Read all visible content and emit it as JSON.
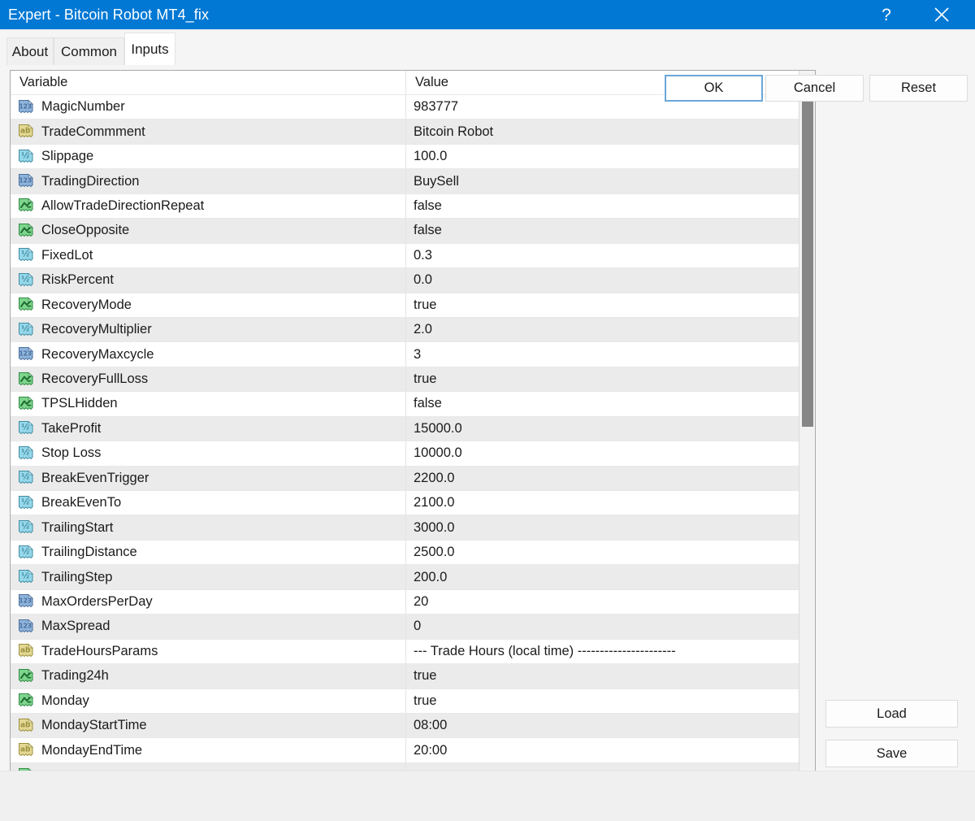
{
  "window": {
    "title": "Expert - Bitcoin Robot MT4_fix",
    "titlebar_color": "#0078d4",
    "help_icon": "question-mark-icon",
    "close_icon": "close-icon"
  },
  "tabs": [
    {
      "label": "About",
      "selected": false
    },
    {
      "label": "Common",
      "selected": false
    },
    {
      "label": "Inputs",
      "selected": true
    }
  ],
  "table": {
    "columns": [
      "Variable",
      "Value"
    ],
    "rows": [
      {
        "icon": "integer-icon",
        "name": "MagicNumber",
        "value": "983777"
      },
      {
        "icon": "string-icon",
        "name": "TradeCommment",
        "value": "Bitcoin Robot"
      },
      {
        "icon": "double-icon",
        "name": "Slippage",
        "value": "100.0"
      },
      {
        "icon": "integer-icon",
        "name": "TradingDirection",
        "value": "BuySell"
      },
      {
        "icon": "bool-icon",
        "name": "AllowTradeDirectionRepeat",
        "value": "false"
      },
      {
        "icon": "bool-icon",
        "name": "CloseOpposite",
        "value": "false"
      },
      {
        "icon": "double-icon",
        "name": "FixedLot",
        "value": "0.3"
      },
      {
        "icon": "double-icon",
        "name": "RiskPercent",
        "value": "0.0"
      },
      {
        "icon": "bool-icon",
        "name": "RecoveryMode",
        "value": "true"
      },
      {
        "icon": "double-icon",
        "name": "RecoveryMultiplier",
        "value": "2.0"
      },
      {
        "icon": "integer-icon",
        "name": "RecoveryMaxcycle",
        "value": "3"
      },
      {
        "icon": "bool-icon",
        "name": "RecoveryFullLoss",
        "value": "true"
      },
      {
        "icon": "bool-icon",
        "name": "TPSLHidden",
        "value": "false"
      },
      {
        "icon": "double-icon",
        "name": "TakeProfit",
        "value": "15000.0"
      },
      {
        "icon": "double-icon",
        "name": "Stop Loss",
        "value": "10000.0"
      },
      {
        "icon": "double-icon",
        "name": "BreakEvenTrigger",
        "value": "2200.0"
      },
      {
        "icon": "double-icon",
        "name": "BreakEvenTo",
        "value": "2100.0"
      },
      {
        "icon": "double-icon",
        "name": "TrailingStart",
        "value": "3000.0"
      },
      {
        "icon": "double-icon",
        "name": "TrailingDistance",
        "value": "2500.0"
      },
      {
        "icon": "double-icon",
        "name": "TrailingStep",
        "value": "200.0"
      },
      {
        "icon": "integer-icon",
        "name": "MaxOrdersPerDay",
        "value": "20"
      },
      {
        "icon": "integer-icon",
        "name": "MaxSpread",
        "value": "0"
      },
      {
        "icon": "string-icon",
        "name": "TradeHoursParams",
        "value": "--- Trade Hours  (local time) ----------------------"
      },
      {
        "icon": "bool-icon",
        "name": "Trading24h",
        "value": "true"
      },
      {
        "icon": "bool-icon",
        "name": "Monday",
        "value": "true"
      },
      {
        "icon": "string-icon",
        "name": "MondayStartTime",
        "value": "08:00"
      },
      {
        "icon": "string-icon",
        "name": "MondayEndTime",
        "value": "20:00"
      },
      {
        "icon": "bool-icon",
        "name": "",
        "value": ""
      }
    ]
  },
  "scrollbar": {
    "name": "vertical-scrollbar"
  },
  "side_buttons": {
    "load": "Load",
    "save": "Save"
  },
  "footer_buttons": {
    "ok": "OK",
    "cancel": "Cancel",
    "reset": "Reset"
  },
  "colors": {
    "accent": "#0078d4",
    "integer_icon": "#7ba3d0",
    "string_icon": "#e0d48a",
    "double_icon": "#8fd4e8",
    "bool_icon": "#7fd68a",
    "row_alt": "#ebebeb",
    "focus_border": "#6ba7d8"
  }
}
